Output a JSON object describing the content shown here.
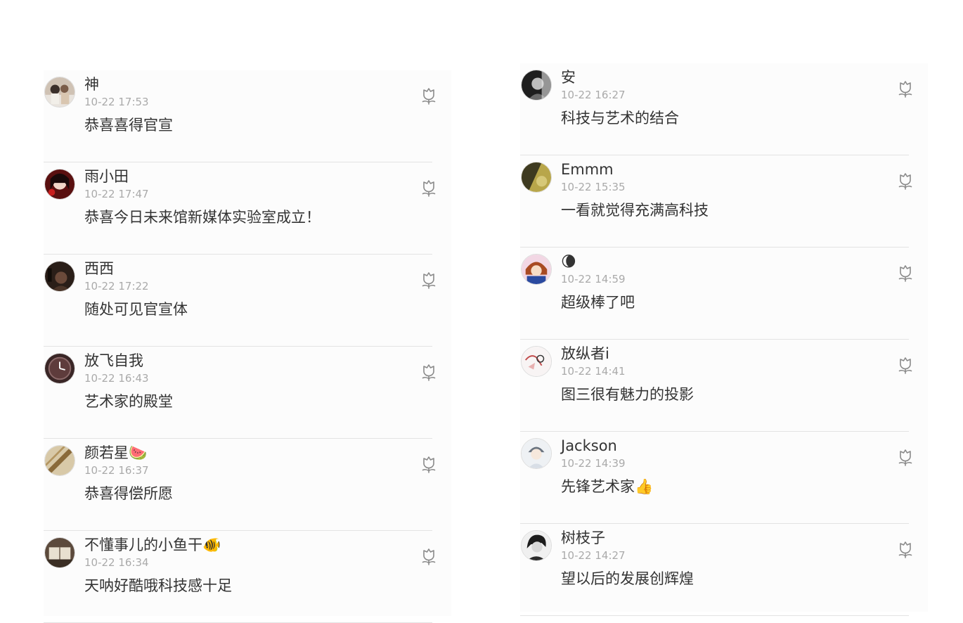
{
  "columns": [
    {
      "comments": [
        {
          "avatar": "avatar-couple-photo",
          "name": "神",
          "time": "10-22 17:53",
          "text": "恭喜喜得官宣"
        },
        {
          "avatar": "avatar-anime-girl-red",
          "name": "雨小田",
          "time": "10-22 17:47",
          "text": "恭喜今日未来馆新媒体实验室成立！"
        },
        {
          "avatar": "avatar-dark-portrait",
          "name": "西西",
          "time": "10-22 17:22",
          "text": "随处可见官宣体"
        },
        {
          "avatar": "avatar-clock",
          "name": "放飞自我",
          "time": "10-22 16:43",
          "text": "艺术家的殿堂"
        },
        {
          "avatar": "avatar-bamboo",
          "name": "颜若星🍉",
          "time": "10-22 16:37",
          "text": "恭喜得偿所愿"
        },
        {
          "avatar": "avatar-book",
          "name": "不懂事儿的小鱼干🐠",
          "time": "10-22 16:34",
          "text": "天呐好酷哦科技感十足"
        }
      ]
    },
    {
      "comments": [
        {
          "avatar": "avatar-dark-person",
          "name": "安",
          "time": "10-22 16:27",
          "text": "科技与艺术的结合"
        },
        {
          "avatar": "avatar-olive",
          "name": "Emmm",
          "time": "10-22 15:35",
          "text": "一看就觉得充满高科技"
        },
        {
          "avatar": "avatar-anime-boy",
          "name": "🌘",
          "time": "10-22 14:59",
          "text": "超级棒了吧"
        },
        {
          "avatar": "avatar-sketch",
          "name": "放纵者i",
          "time": "10-22 14:41",
          "text": "图三很有魅力的投影"
        },
        {
          "avatar": "avatar-cartoon-boy",
          "name": "Jackson",
          "time": "10-22 14:39",
          "text": "先锋艺术家👍"
        },
        {
          "avatar": "avatar-bw-girl",
          "name": "树枝子",
          "time": "10-22 14:27",
          "text": "望以后的发展创辉煌"
        }
      ]
    }
  ],
  "like_icon": "flower-like-icon"
}
